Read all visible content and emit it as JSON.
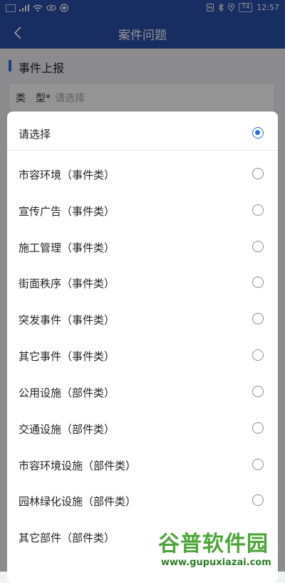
{
  "status_bar": {
    "time": "12:57",
    "battery": "74"
  },
  "app_bar": {
    "title": "案件问题"
  },
  "section": {
    "title": "事件上报"
  },
  "form": {
    "type_label": "类　型",
    "required_mark": "*",
    "type_placeholder": "请选择"
  },
  "options": [
    {
      "label": "请选择",
      "selected": true
    },
    {
      "label": "市容环境（事件类）",
      "selected": false
    },
    {
      "label": "宣传广告（事件类）",
      "selected": false
    },
    {
      "label": "施工管理（事件类）",
      "selected": false
    },
    {
      "label": "街面秩序（事件类）",
      "selected": false
    },
    {
      "label": "突发事件（事件类）",
      "selected": false
    },
    {
      "label": "其它事件（事件类）",
      "selected": false
    },
    {
      "label": "公用设施（部件类）",
      "selected": false
    },
    {
      "label": "交通设施（部件类）",
      "selected": false
    },
    {
      "label": "市容环境设施（部件类）",
      "selected": false
    },
    {
      "label": "园林绿化设施（部件类）",
      "selected": false
    },
    {
      "label": "其它部件（部件类）",
      "selected": false
    }
  ],
  "watermark": {
    "text": "谷普软件园",
    "url": "www.gupuxiazai.com"
  },
  "colors": {
    "primary": "#2a4fa8",
    "accent": "#2d6be4"
  }
}
